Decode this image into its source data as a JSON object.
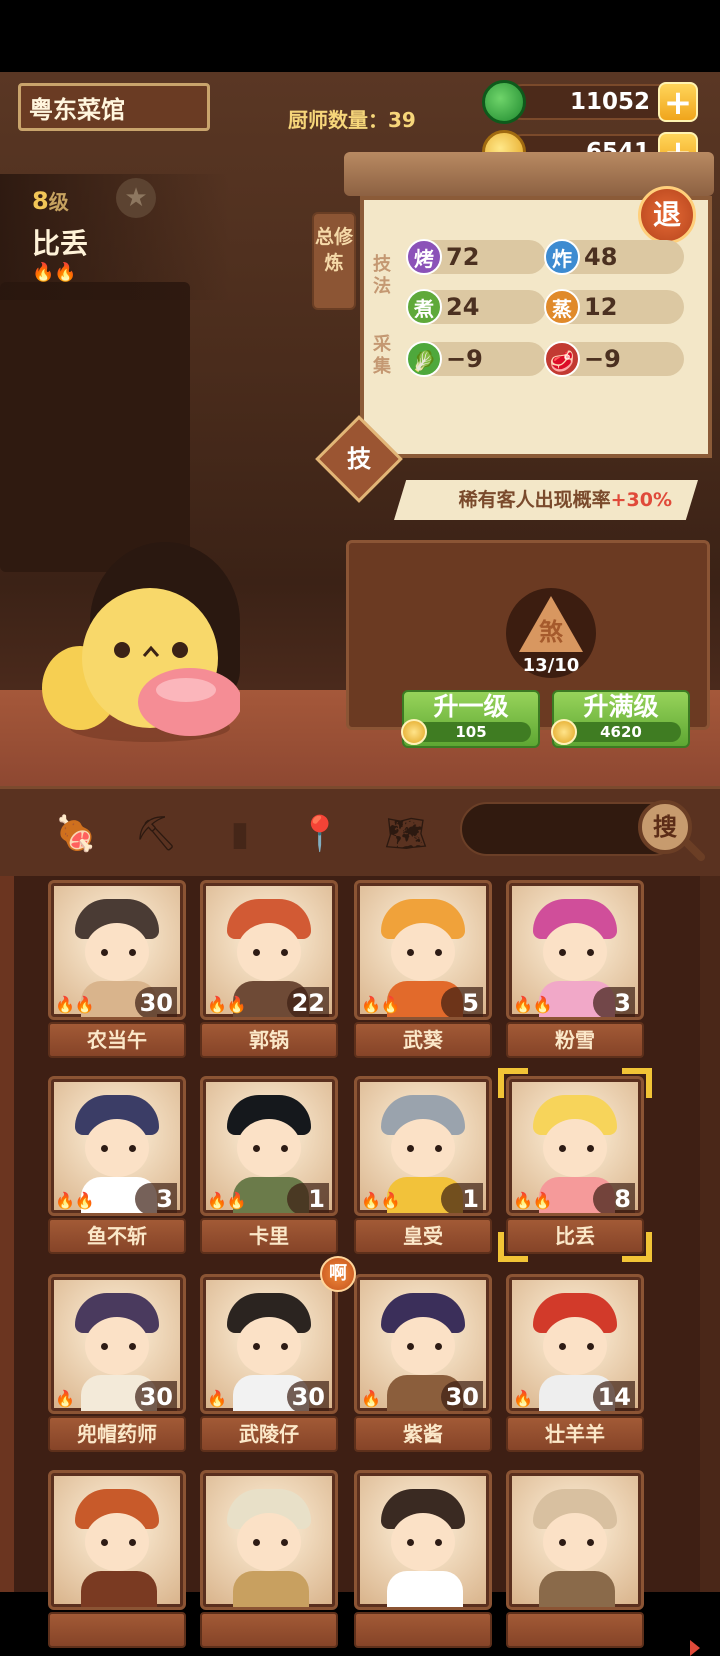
{
  "restaurant": {
    "name": "粤东菜馆"
  },
  "chef_count": {
    "label": "厨师数量：39"
  },
  "resources": {
    "jade": {
      "value": "11052",
      "plus": "+"
    },
    "coins": {
      "value": "6541",
      "plus": "+"
    }
  },
  "chef": {
    "level_number": "8",
    "level_suffix": "级",
    "name": "比丢",
    "star": "★",
    "flames": "🔥🔥"
  },
  "training": {
    "tab_label": "总修炼",
    "quit_label": "退",
    "group_skill_label": "技法",
    "group_gather_label": "采集",
    "skills": [
      {
        "icon": "烤",
        "value": "72",
        "color": "#8b52b8"
      },
      {
        "icon": "炸",
        "value": "48",
        "color": "#3d8bd1"
      },
      {
        "icon": "煮",
        "value": "24",
        "color": "#5fa93a"
      },
      {
        "icon": "蒸",
        "value": "12",
        "color": "#e08a2b"
      },
      {
        "icon": "🥬",
        "value": "−9",
        "color": "#4ea83c"
      },
      {
        "icon": "🥩",
        "value": "−9",
        "color": "#c23a32"
      }
    ],
    "ji_badge": "技",
    "rare_text": "稀有客人出现概率",
    "rare_pct": "+30%",
    "token_char": "煞",
    "token_count": "13/10",
    "upgrade_one": {
      "label": "升一级",
      "cost": "105"
    },
    "upgrade_max": {
      "label": "升满级",
      "cost": "4620"
    }
  },
  "toolbar": {
    "icons": [
      "meat-icon",
      "shovel-icon",
      "jar-icon",
      "location-icon",
      "map-question-icon"
    ],
    "search_label": "搜",
    "search_placeholder": ""
  },
  "hint_badge": "啊",
  "chefs_grid": [
    {
      "name": "农当午",
      "level": "30",
      "flames": "🔥🔥",
      "hair": "#4a3b34",
      "accent": "#d9b48c"
    },
    {
      "name": "郭锅",
      "level": "22",
      "flames": "🔥🔥",
      "hair": "#d25a34",
      "accent": "#6e4a36"
    },
    {
      "name": "武葵",
      "level": "5",
      "flames": "🔥🔥",
      "hair": "#f0a23a",
      "accent": "#e26a2b"
    },
    {
      "name": "粉雪",
      "level": "3",
      "flames": "🔥🔥",
      "hair": "#d04e9a",
      "accent": "#f1a8c8"
    },
    {
      "name": "鱼不斩",
      "level": "3",
      "flames": "🔥🔥",
      "hair": "#3b3d66",
      "accent": "#ffffff"
    },
    {
      "name": "卡里",
      "level": "1",
      "flames": "🔥🔥",
      "hair": "#15181c",
      "accent": "#6b7b4a"
    },
    {
      "name": "皇受",
      "level": "1",
      "flames": "🔥🔥",
      "hair": "#9aa3ad",
      "accent": "#f2c23a"
    },
    {
      "name": "比丢",
      "level": "8",
      "flames": "🔥🔥",
      "hair": "#f7d45a",
      "accent": "#f59a9a",
      "selected": true
    },
    {
      "name": "兜帽药师",
      "level": "30",
      "flames": "🔥",
      "hair": "#4a3a5e",
      "accent": "#f3ead9"
    },
    {
      "name": "武陵仔",
      "level": "30",
      "flames": "🔥",
      "hair": "#2b2420",
      "accent": "#f2f2f2"
    },
    {
      "name": "紫酱",
      "level": "30",
      "flames": "🔥",
      "hair": "#3b2f5a",
      "accent": "#8b5e3c"
    },
    {
      "name": "壮羊羊",
      "level": "14",
      "flames": "🔥",
      "hair": "#d23a2a",
      "accent": "#eeeeee"
    },
    {
      "name": "",
      "level": "",
      "flames": "",
      "hair": "#c85a2a",
      "accent": "#7a3a22"
    },
    {
      "name": "",
      "level": "",
      "flames": "",
      "hair": "#e8e0c8",
      "accent": "#c8a060"
    },
    {
      "name": "",
      "level": "",
      "flames": "",
      "hair": "#3a2a22",
      "accent": "#ffffff"
    },
    {
      "name": "",
      "level": "",
      "flames": "",
      "hair": "#d8c0a0",
      "accent": "#8a6a4a"
    }
  ]
}
